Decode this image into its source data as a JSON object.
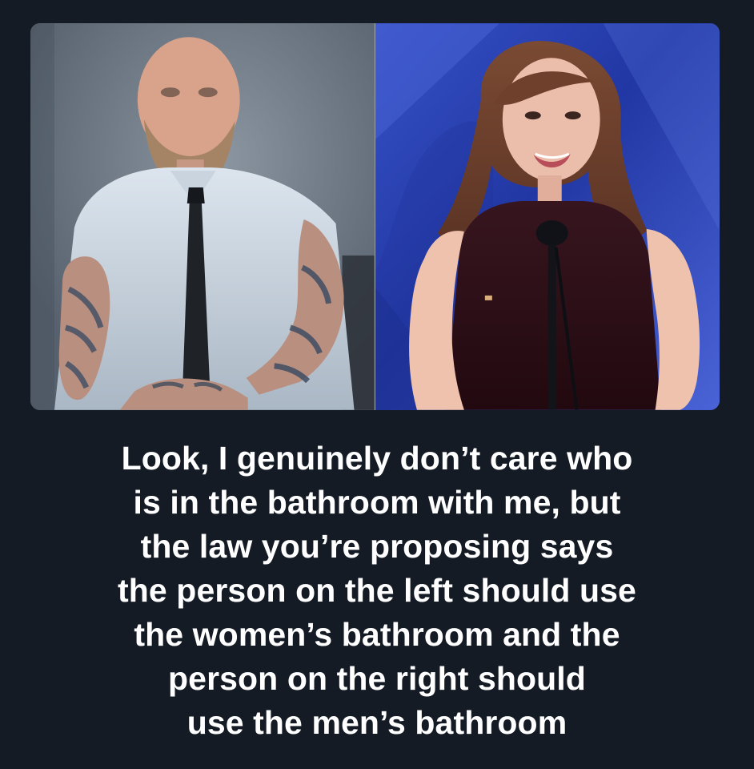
{
  "caption": {
    "lines": [
      "Look, I genuinely don’t care who",
      "is in the bathroom with me, but",
      "the law you’re proposing says",
      "the person on the left should use",
      "the women’s bathroom and the",
      "person on the right should",
      "use the men’s bathroom"
    ]
  },
  "photos": {
    "left_icon": "bald-bearded-man-with-tie-photo",
    "right_icon": "woman-speaking-at-microphone-photo"
  },
  "colors": {
    "page_background": "#141b25",
    "caption_text": "#ffffff",
    "right_background_blue": "#2a43b6"
  }
}
